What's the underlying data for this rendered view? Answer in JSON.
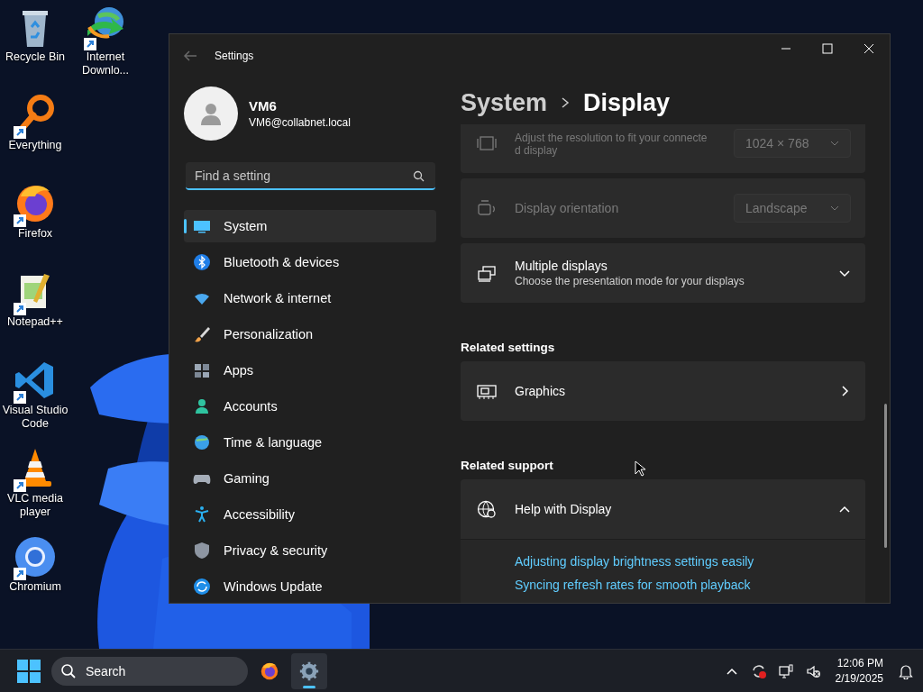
{
  "desktop": {
    "icons": [
      {
        "label": "Recycle Bin",
        "kind": "recycle",
        "shortcut": false
      },
      {
        "label": "Internet Downlo...",
        "kind": "download",
        "shortcut": true
      },
      {
        "label": "Everything",
        "kind": "everything",
        "shortcut": true
      },
      {
        "label": "Firefox",
        "kind": "firefox",
        "shortcut": true
      },
      {
        "label": "Notepad++",
        "kind": "notepad",
        "shortcut": true
      },
      {
        "label": "Visual Studio Code",
        "kind": "vscode",
        "shortcut": true
      },
      {
        "label": "VLC media player",
        "kind": "vlc",
        "shortcut": true
      },
      {
        "label": "Chromium",
        "kind": "chromium",
        "shortcut": true
      }
    ]
  },
  "window": {
    "title": "Settings",
    "account": {
      "name": "VM6",
      "email": "VM6@collabnet.local"
    },
    "search": {
      "placeholder": "Find a setting"
    },
    "nav": [
      {
        "label": "System",
        "kind": "system",
        "selected": true
      },
      {
        "label": "Bluetooth & devices",
        "kind": "bluetooth",
        "selected": false
      },
      {
        "label": "Network & internet",
        "kind": "network",
        "selected": false
      },
      {
        "label": "Personalization",
        "kind": "brush",
        "selected": false
      },
      {
        "label": "Apps",
        "kind": "apps",
        "selected": false
      },
      {
        "label": "Accounts",
        "kind": "accounts",
        "selected": false
      },
      {
        "label": "Time & language",
        "kind": "time",
        "selected": false
      },
      {
        "label": "Gaming",
        "kind": "gaming",
        "selected": false
      },
      {
        "label": "Accessibility",
        "kind": "accessibility",
        "selected": false
      },
      {
        "label": "Privacy & security",
        "kind": "privacy",
        "selected": false
      },
      {
        "label": "Windows Update",
        "kind": "update",
        "selected": false
      }
    ],
    "breadcrumb": {
      "parent": "System",
      "current": "Display"
    },
    "sections": [
      {
        "cards": [
          {
            "kind": "resolution",
            "description": "Adjust the resolution to fit your connected display",
            "value": "1024 × 768",
            "disabled": true
          },
          {
            "kind": "orientation",
            "title": "Display orientation",
            "value": "Landscape",
            "disabled": true
          },
          {
            "kind": "multiple",
            "title": "Multiple displays",
            "description": "Choose the presentation mode for your displays",
            "expanded": false,
            "disabled": false
          }
        ]
      },
      {
        "heading": "Related settings",
        "cards": [
          {
            "kind": "graphics",
            "title": "Graphics",
            "disabled": false
          }
        ]
      },
      {
        "heading": "Related support",
        "cards": [
          {
            "kind": "help",
            "title": "Help with Display",
            "expanded": true,
            "disabled": false,
            "links": [
              "Adjusting display brightness settings easily",
              "Syncing refresh rates for smooth playback"
            ]
          }
        ]
      }
    ]
  },
  "taskbar": {
    "search": {
      "placeholder": "Search"
    },
    "apps": [
      {
        "kind": "firefox",
        "active": false
      },
      {
        "kind": "settings",
        "active": true
      }
    ],
    "time": "12:06 PM",
    "date": "2/19/2025"
  }
}
